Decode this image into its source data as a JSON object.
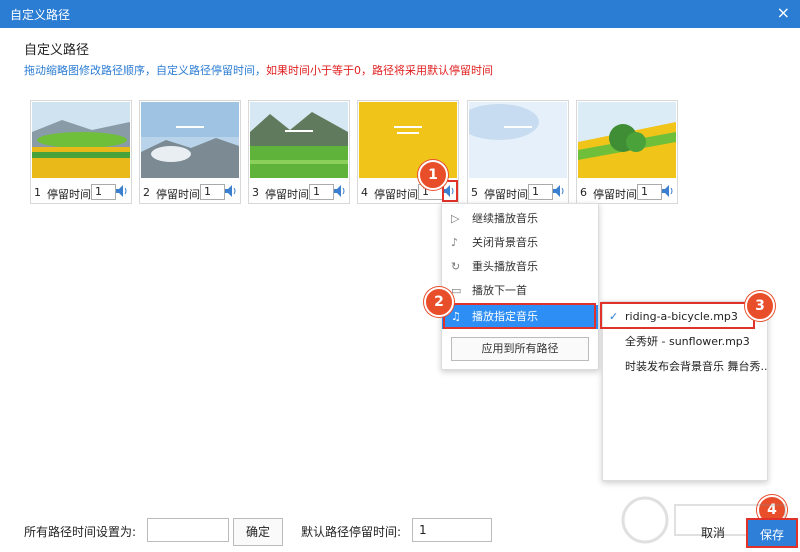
{
  "window": {
    "title": "自定义路径"
  },
  "heading": "自定义路径",
  "hint": {
    "part1": "拖动缩略图修改路径顺序，自定义路径停留时间，",
    "part2": "如果时间小于等于0，路径将采用默认停留时间"
  },
  "thumbs": [
    {
      "index": "1",
      "label": "停留时间",
      "value": "1"
    },
    {
      "index": "2",
      "label": "停留时间",
      "value": "1"
    },
    {
      "index": "3",
      "label": "停留时间",
      "value": "1"
    },
    {
      "index": "4",
      "label": "停留时间",
      "value": "1"
    },
    {
      "index": "5",
      "label": "停留时间",
      "value": "1"
    },
    {
      "index": "6",
      "label": "停留时间",
      "value": "1"
    }
  ],
  "menu": {
    "items": [
      {
        "label": "继续播放音乐",
        "icon": "play-icon"
      },
      {
        "label": "关闭背景音乐",
        "icon": "mute-icon"
      },
      {
        "label": "重头播放音乐",
        "icon": "replay-icon"
      },
      {
        "label": "播放下一首",
        "icon": "next-icon"
      },
      {
        "label": "播放指定音乐",
        "icon": "music-icon"
      }
    ],
    "apply_label": "应用到所有路径"
  },
  "submenu": {
    "items": [
      {
        "label": "riding-a-bicycle.mp3",
        "checked": true
      },
      {
        "label": "全秀妍 - sunflower.mp3",
        "checked": false
      },
      {
        "label": "时装发布会背景音乐 舞台秀...",
        "checked": false
      }
    ]
  },
  "badges": [
    "1",
    "2",
    "3",
    "4"
  ],
  "footer": {
    "all_time_label": "所有路径时间设置为:",
    "all_time_value": "",
    "confirm_label": "确定",
    "default_label": "默认路径停留时间:",
    "default_value": "1",
    "cancel_label": "取消",
    "save_label": "保存"
  },
  "colors": {
    "titlebar": "#2b7cd3",
    "accent": "#2d8ef5",
    "badge": "#e94e2b",
    "highlight": "#e0312a"
  }
}
